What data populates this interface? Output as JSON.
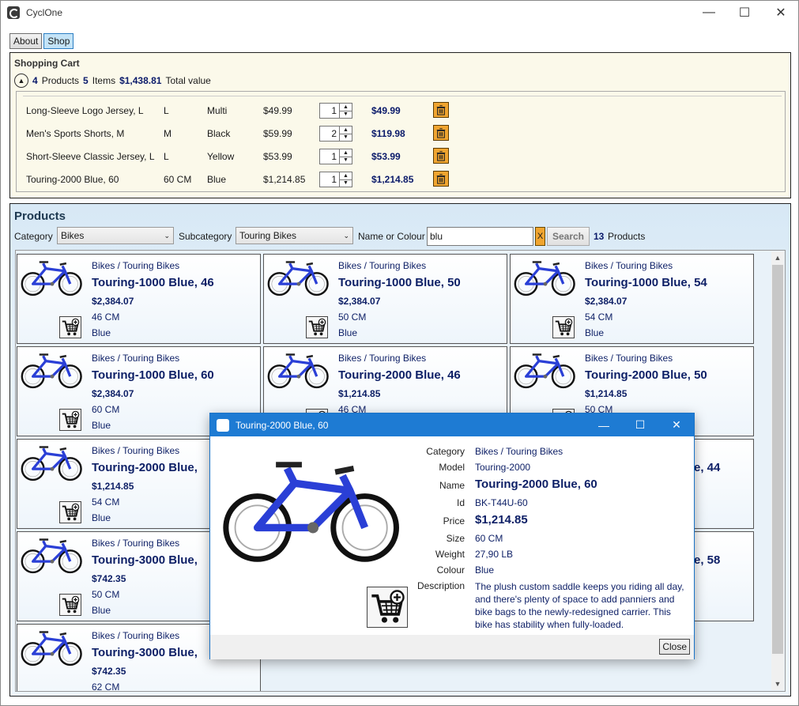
{
  "app": {
    "title": "CyclOne"
  },
  "tabs": [
    {
      "label": "About"
    },
    {
      "label": "Shop"
    }
  ],
  "cart": {
    "title": "Shopping Cart",
    "product_count": "4",
    "product_count_label": "Products",
    "item_count": "5",
    "item_count_label": "Items",
    "total_value": "$1,438.81",
    "total_label": "Total value",
    "rows": [
      {
        "name": "Long-Sleeve Logo Jersey, L",
        "size": "L",
        "colour": "Multi",
        "price": "$49.99",
        "qty": "1",
        "total": "$49.99"
      },
      {
        "name": "Men's Sports Shorts, M",
        "size": "M",
        "colour": "Black",
        "price": "$59.99",
        "qty": "2",
        "total": "$119.98"
      },
      {
        "name": "Short-Sleeve Classic Jersey, L",
        "size": "L",
        "colour": "Yellow",
        "price": "$53.99",
        "qty": "1",
        "total": "$53.99"
      },
      {
        "name": "Touring-2000 Blue, 60",
        "size": "60 CM",
        "colour": "Blue",
        "price": "$1,214.85",
        "qty": "1",
        "total": "$1,214.85"
      }
    ]
  },
  "products": {
    "title": "Products",
    "category_label": "Category",
    "category_value": "Bikes",
    "subcategory_label": "Subcategory",
    "subcategory_value": "Touring Bikes",
    "search_label": "Name or Colour",
    "search_value": "blu",
    "clear_label": "X",
    "search_button": "Search",
    "result_count": "13",
    "result_label": "Products",
    "cards": [
      {
        "category": "Bikes / Touring Bikes",
        "name": "Touring-1000 Blue, 46",
        "price": "$2,384.07",
        "size": "46 CM",
        "colour": "Blue"
      },
      {
        "category": "Bikes / Touring Bikes",
        "name": "Touring-1000 Blue, 50",
        "price": "$2,384.07",
        "size": "50 CM",
        "colour": "Blue"
      },
      {
        "category": "Bikes / Touring Bikes",
        "name": "Touring-1000 Blue, 54",
        "price": "$2,384.07",
        "size": "54 CM",
        "colour": "Blue"
      },
      {
        "category": "Bikes / Touring Bikes",
        "name": "Touring-1000 Blue, 60",
        "price": "$2,384.07",
        "size": "60 CM",
        "colour": "Blue"
      },
      {
        "category": "Bikes / Touring Bikes",
        "name": "Touring-2000 Blue, 46",
        "price": "$1,214.85",
        "size": "46 CM",
        "colour": ""
      },
      {
        "category": "Bikes / Touring Bikes",
        "name": "Touring-2000 Blue, 50",
        "price": "$1,214.85",
        "size": "50 CM",
        "colour": ""
      },
      {
        "category": "Bikes / Touring Bikes",
        "name": "Touring-2000 Blue,",
        "price": "$1,214.85",
        "size": "54 CM",
        "colour": "Blue"
      },
      {
        "category": "",
        "name": "e, 44",
        "price": "",
        "size": "",
        "colour": ""
      },
      {
        "category": "Bikes / Touring Bikes",
        "name": "Touring-3000 Blue,",
        "price": "$742.35",
        "size": "50 CM",
        "colour": "Blue"
      },
      {
        "category": "",
        "name": "e, 58",
        "price": "",
        "size": "",
        "colour": ""
      },
      {
        "category": "Bikes / Touring Bikes",
        "name": "Touring-3000 Blue,",
        "price": "$742.35",
        "size": "62 CM",
        "colour": ""
      }
    ]
  },
  "dialog": {
    "title": "Touring-2000 Blue, 60",
    "fields": {
      "category_label": "Category",
      "category": "Bikes / Touring Bikes",
      "model_label": "Model",
      "model": "Touring-2000",
      "name_label": "Name",
      "name": "Touring-2000 Blue, 60",
      "id_label": "Id",
      "id": "BK-T44U-60",
      "price_label": "Price",
      "price": "$1,214.85",
      "size_label": "Size",
      "size": "60 CM",
      "weight_label": "Weight",
      "weight": "27,90 LB",
      "colour_label": "Colour",
      "colour": "Blue",
      "description_label": "Description",
      "description": "The plush custom saddle keeps you riding all day, and there's plenty of space to add panniers and bike bags to the newly-redesigned carrier.  This bike has stability when fully-loaded."
    },
    "close_button": "Close"
  },
  "icons": {
    "app": "app-logo-icon",
    "cart_add": "cart-add-icon",
    "trash": "trash-icon",
    "bike": "bike-image"
  },
  "colors": {
    "accent_blue": "#1e7bd3",
    "text_navy": "#0d1f66",
    "orange": "#f0a530",
    "cart_bg": "#fbf9ea"
  }
}
